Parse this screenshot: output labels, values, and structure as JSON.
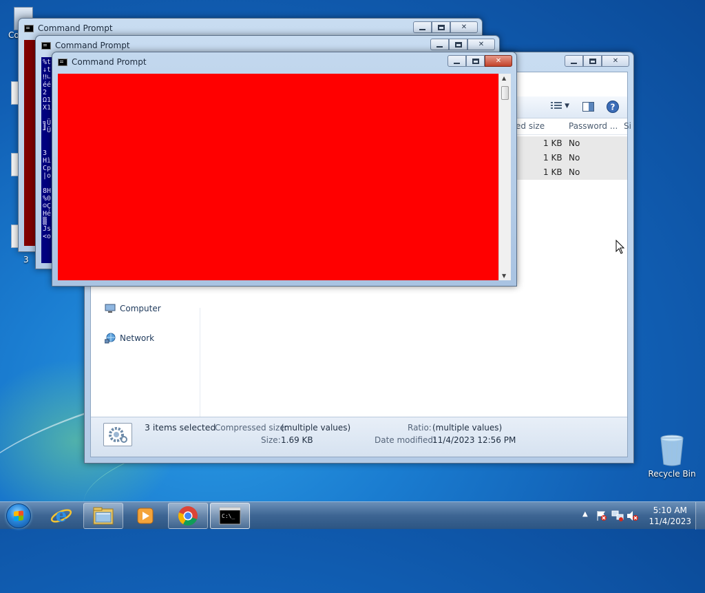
{
  "desktop": {
    "partial_icon_label": "Co",
    "partial_label_3": "3",
    "recycle_bin_label": "Recycle Bin"
  },
  "explorer": {
    "columns": {
      "compressed_size": "ed size",
      "password": "Password ...",
      "size": "Si"
    },
    "rows": [
      {
        "compressed": "1 KB",
        "password": "No"
      },
      {
        "compressed": "1 KB",
        "password": "No"
      },
      {
        "compressed": "1 KB",
        "password": "No"
      }
    ],
    "nav": {
      "computer": "Computer",
      "network": "Network"
    },
    "details": {
      "selected": "3 items selected",
      "compressed_label": "Compressed size:",
      "compressed_value": "(multiple values)",
      "size_label": "Size:",
      "size_value": "1.69 KB",
      "ratio_label": "Ratio:",
      "ratio_value": "(multiple values)",
      "date_label": "Date modified:",
      "date_value": "11/4/2023 12:56 PM"
    }
  },
  "cmd_windows": [
    {
      "title": "Command Prompt",
      "console_color": "#800000"
    },
    {
      "title": "Command Prompt",
      "console_color": "#000080",
      "visible_text": "%t\n↓t\n‼∟\néé\n2\nΩ1\nX1\n \n╗Ü\n╜Ü\n \n \n3\nHì\nCp\n|o\n \n8H\n%0\n☺Ç\nHé\n▒\nJs\n<o"
    },
    {
      "title": "Command Prompt",
      "console_color": "#ff0000"
    }
  ],
  "taskbar": {
    "icons": [
      "start-orb",
      "internet-explorer-icon",
      "windows-explorer-icon",
      "media-player-icon",
      "chrome-icon",
      "command-prompt-icon"
    ],
    "time": "5:10 AM",
    "date": "11/4/2023"
  }
}
